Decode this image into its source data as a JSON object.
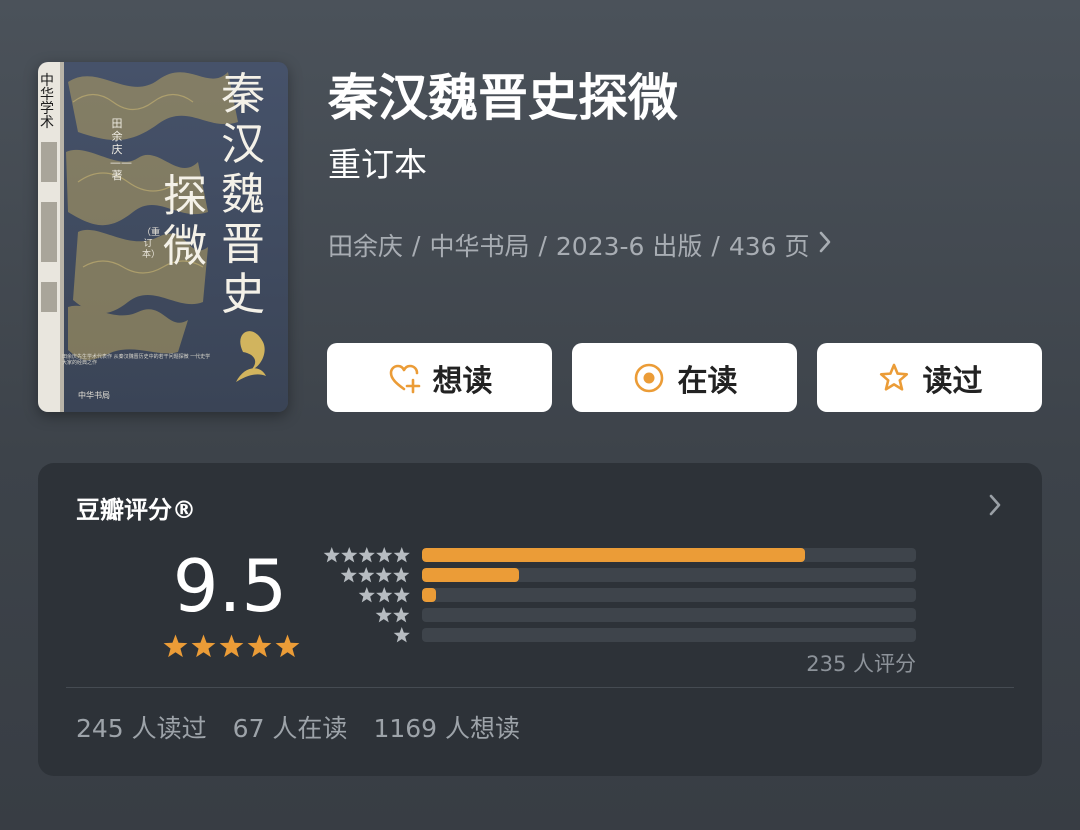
{
  "colors": {
    "accent": "#eb9c37",
    "page_background": "#454b52",
    "card_background": "#2d3238",
    "button_background": "#ffffff"
  },
  "cover": {
    "title_col1": "秦汉魏晋史",
    "title_col2": "探微",
    "author": "田余庆——著",
    "edition": "（重订本）",
    "series_logo": "中华学术",
    "blurb": "田余庆先生学术代表作 从秦汉魏晋历史中的若干问题探微 一代史学大家的经典之作",
    "publisher": "中华书局"
  },
  "book": {
    "title": "秦汉魏晋史探微",
    "subtitle": "重订本",
    "meta": {
      "author": "田余庆",
      "publisher": "中华书局",
      "date": "2023-6 出版",
      "pages": "436 页",
      "separator": "/",
      "chevron": "›"
    }
  },
  "actions": [
    {
      "label": "想读",
      "icon": "heart-plus-icon"
    },
    {
      "label": "在读",
      "icon": "target-circle-icon"
    },
    {
      "label": "读过",
      "icon": "star-outline-icon"
    }
  ],
  "rating": {
    "heading": "豆瓣评分®",
    "chevron": "›",
    "score": "9.5",
    "score_stars": 5,
    "distribution": [
      {
        "stars": 5,
        "fraction": 0.776
      },
      {
        "stars": 4,
        "fraction": 0.196
      },
      {
        "stars": 3,
        "fraction": 0.028
      },
      {
        "stars": 2,
        "fraction": 0.0
      },
      {
        "stars": 1,
        "fraction": 0.0
      }
    ],
    "count_text": "235 人评分",
    "stats": {
      "read": "245 人读过",
      "reading": "67 人在读",
      "want": "1169 人想读"
    }
  }
}
